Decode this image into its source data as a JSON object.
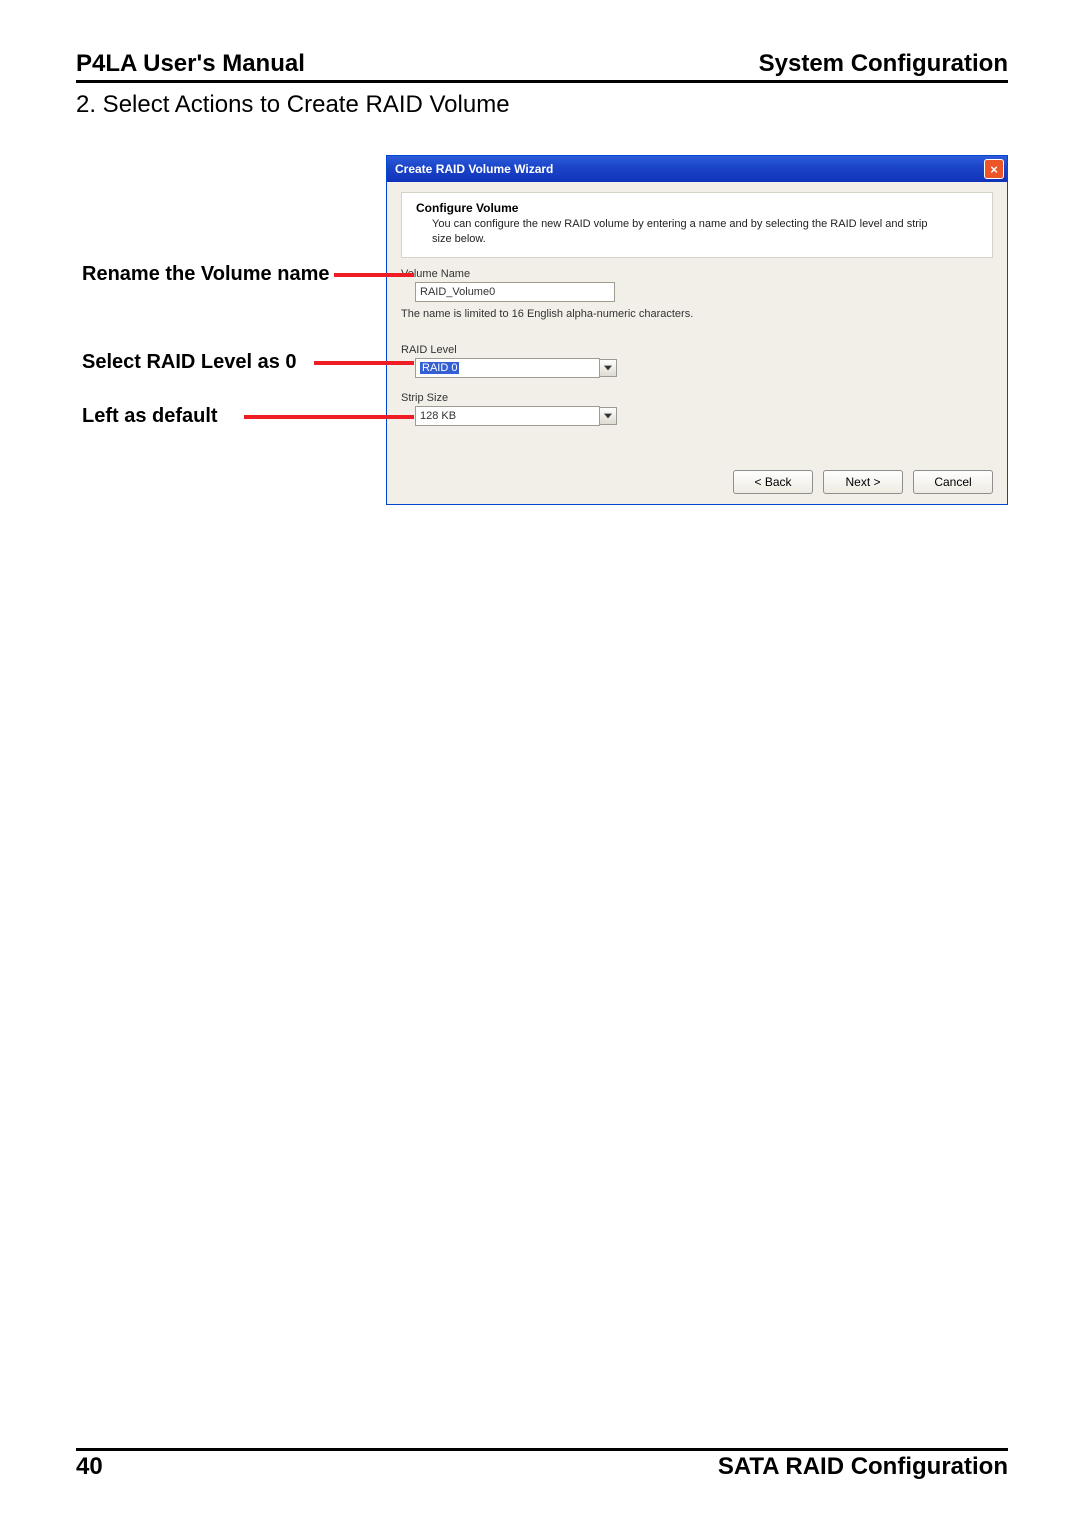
{
  "header": {
    "left": "P4LA User's Manual",
    "right": "System Configuration"
  },
  "step_line": "2. Select Actions to Create RAID Volume",
  "callouts": {
    "rename": "Rename the Volume name",
    "raid_level": "Select RAID Level as 0",
    "strip": "Left as default"
  },
  "dialog": {
    "title": "Create RAID Volume Wizard",
    "close": "×",
    "configure_title": "Configure Volume",
    "configure_desc": "You can configure the new RAID volume by entering a name and by selecting the RAID level and strip size below.",
    "volume_name_label": "Volume Name",
    "volume_name_value": "RAID_Volume0",
    "volume_name_helper": "The name is limited to 16 English alpha-numeric characters.",
    "raid_level_label": "RAID Level",
    "raid_level_value": "RAID 0",
    "strip_size_label": "Strip Size",
    "strip_size_value": "128 KB",
    "buttons": {
      "back": "< Back",
      "next": "Next >",
      "cancel": "Cancel"
    }
  },
  "footer": {
    "page": "40",
    "section": "SATA  RAID  Configuration"
  }
}
